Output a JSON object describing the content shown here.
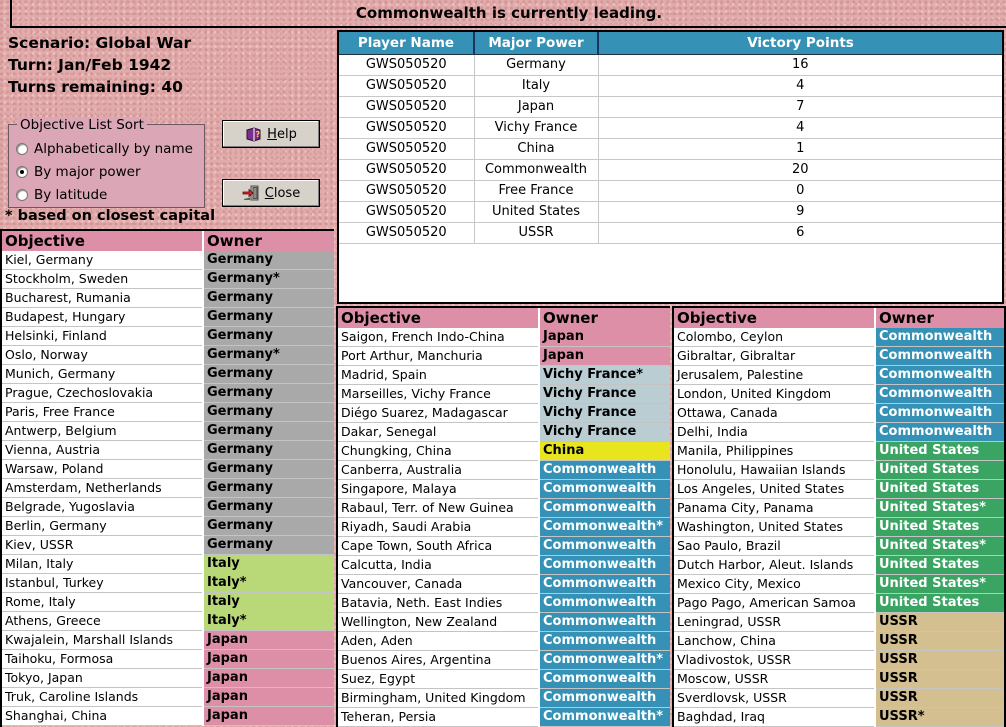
{
  "title": "Commonwealth is currently leading.",
  "scenario": {
    "scenario_line": "Scenario: Global War",
    "turn_line": "Turn: Jan/Feb 1942",
    "remaining_line": "Turns remaining: 40"
  },
  "sort_box": {
    "label": "Objective List Sort",
    "options": [
      {
        "label": "Alphabetically by name",
        "selected": false
      },
      {
        "label": "By major power",
        "selected": true
      },
      {
        "label": "By latitude",
        "selected": false
      }
    ]
  },
  "buttons": {
    "help_label": "Help",
    "close_label": "Close"
  },
  "footnote": "* based on closest capital",
  "victory_table": {
    "columns": [
      "Player Name",
      "Major Power",
      "Victory Points"
    ],
    "rows": [
      {
        "player": "GWS050520",
        "power": "Germany",
        "points": "16"
      },
      {
        "player": "GWS050520",
        "power": "Italy",
        "points": "4"
      },
      {
        "player": "GWS050520",
        "power": "Japan",
        "points": "7"
      },
      {
        "player": "GWS050520",
        "power": "Vichy France",
        "points": "4"
      },
      {
        "player": "GWS050520",
        "power": "China",
        "points": "1"
      },
      {
        "player": "GWS050520",
        "power": "Commonwealth",
        "points": "20"
      },
      {
        "player": "GWS050520",
        "power": "Free France",
        "points": "0"
      },
      {
        "player": "GWS050520",
        "power": "United States",
        "points": "9"
      },
      {
        "player": "GWS050520",
        "power": "USSR",
        "points": "6"
      }
    ]
  },
  "list_headers": {
    "objective": "Objective",
    "owner": "Owner"
  },
  "owner_styles": {
    "Germany": {
      "bg": "#a9a9a9",
      "fg": "#000000"
    },
    "Italy": {
      "bg": "#b9d878",
      "fg": "#000000"
    },
    "Japan": {
      "bg": "#de8fa8",
      "fg": "#000000"
    },
    "Vichy France": {
      "bg": "#b9cdd3",
      "fg": "#000000"
    },
    "China": {
      "bg": "#e8e51e",
      "fg": "#000000"
    },
    "Commonwealth": {
      "bg": "#3591b5",
      "fg": "#ffffff"
    },
    "United States": {
      "bg": "#3aa563",
      "fg": "#ffffff"
    },
    "USSR": {
      "bg": "#d3bf90",
      "fg": "#000000"
    }
  },
  "objective_lists": [
    {
      "rows": [
        {
          "objective": "Kiel, Germany",
          "owner": "Germany",
          "power": "Germany"
        },
        {
          "objective": "Stockholm, Sweden",
          "owner": "Germany*",
          "power": "Germany"
        },
        {
          "objective": "Bucharest, Rumania",
          "owner": "Germany",
          "power": "Germany"
        },
        {
          "objective": "Budapest, Hungary",
          "owner": "Germany",
          "power": "Germany"
        },
        {
          "objective": "Helsinki, Finland",
          "owner": "Germany",
          "power": "Germany"
        },
        {
          "objective": "Oslo, Norway",
          "owner": "Germany*",
          "power": "Germany"
        },
        {
          "objective": "Munich, Germany",
          "owner": "Germany",
          "power": "Germany"
        },
        {
          "objective": "Prague, Czechoslovakia",
          "owner": "Germany",
          "power": "Germany"
        },
        {
          "objective": "Paris, Free France",
          "owner": "Germany",
          "power": "Germany"
        },
        {
          "objective": "Antwerp, Belgium",
          "owner": "Germany",
          "power": "Germany"
        },
        {
          "objective": "Vienna, Austria",
          "owner": "Germany",
          "power": "Germany"
        },
        {
          "objective": "Warsaw, Poland",
          "owner": "Germany",
          "power": "Germany"
        },
        {
          "objective": "Amsterdam, Netherlands",
          "owner": "Germany",
          "power": "Germany"
        },
        {
          "objective": "Belgrade, Yugoslavia",
          "owner": "Germany",
          "power": "Germany"
        },
        {
          "objective": "Berlin, Germany",
          "owner": "Germany",
          "power": "Germany"
        },
        {
          "objective": "Kiev, USSR",
          "owner": "Germany",
          "power": "Germany"
        },
        {
          "objective": "Milan, Italy",
          "owner": "Italy",
          "power": "Italy"
        },
        {
          "objective": "Istanbul, Turkey",
          "owner": "Italy*",
          "power": "Italy"
        },
        {
          "objective": "Rome, Italy",
          "owner": "Italy",
          "power": "Italy"
        },
        {
          "objective": "Athens, Greece",
          "owner": "Italy*",
          "power": "Italy"
        },
        {
          "objective": "Kwajalein, Marshall Islands",
          "owner": "Japan",
          "power": "Japan"
        },
        {
          "objective": "Taihoku, Formosa",
          "owner": "Japan",
          "power": "Japan"
        },
        {
          "objective": "Tokyo, Japan",
          "owner": "Japan",
          "power": "Japan"
        },
        {
          "objective": "Truk, Caroline Islands",
          "owner": "Japan",
          "power": "Japan"
        },
        {
          "objective": "Shanghai, China",
          "owner": "Japan",
          "power": "Japan"
        }
      ]
    },
    {
      "rows": [
        {
          "objective": "Saigon, French Indo-China",
          "owner": "Japan",
          "power": "Japan"
        },
        {
          "objective": "Port Arthur, Manchuria",
          "owner": "Japan",
          "power": "Japan"
        },
        {
          "objective": "Madrid, Spain",
          "owner": "Vichy France*",
          "power": "Vichy France"
        },
        {
          "objective": "Marseilles, Vichy France",
          "owner": "Vichy France",
          "power": "Vichy France"
        },
        {
          "objective": "Diégo Suarez, Madagascar",
          "owner": "Vichy France",
          "power": "Vichy France"
        },
        {
          "objective": "Dakar, Senegal",
          "owner": "Vichy France",
          "power": "Vichy France"
        },
        {
          "objective": "Chungking, China",
          "owner": "China",
          "power": "China"
        },
        {
          "objective": "Canberra, Australia",
          "owner": "Commonwealth",
          "power": "Commonwealth"
        },
        {
          "objective": "Singapore, Malaya",
          "owner": "Commonwealth",
          "power": "Commonwealth"
        },
        {
          "objective": "Rabaul, Terr. of New Guinea",
          "owner": "Commonwealth",
          "power": "Commonwealth"
        },
        {
          "objective": "Riyadh, Saudi Arabia",
          "owner": "Commonwealth*",
          "power": "Commonwealth"
        },
        {
          "objective": "Cape Town, South Africa",
          "owner": "Commonwealth",
          "power": "Commonwealth"
        },
        {
          "objective": "Calcutta, India",
          "owner": "Commonwealth",
          "power": "Commonwealth"
        },
        {
          "objective": "Vancouver, Canada",
          "owner": "Commonwealth",
          "power": "Commonwealth"
        },
        {
          "objective": "Batavia, Neth. East Indies",
          "owner": "Commonwealth",
          "power": "Commonwealth"
        },
        {
          "objective": "Wellington, New Zealand",
          "owner": "Commonwealth",
          "power": "Commonwealth"
        },
        {
          "objective": "Aden, Aden",
          "owner": "Commonwealth",
          "power": "Commonwealth"
        },
        {
          "objective": "Buenos Aires, Argentina",
          "owner": "Commonwealth*",
          "power": "Commonwealth"
        },
        {
          "objective": "Suez, Egypt",
          "owner": "Commonwealth",
          "power": "Commonwealth"
        },
        {
          "objective": "Birmingham, United Kingdom",
          "owner": "Commonwealth",
          "power": "Commonwealth"
        },
        {
          "objective": "Teheran, Persia",
          "owner": "Commonwealth*",
          "power": "Commonwealth"
        }
      ]
    },
    {
      "rows": [
        {
          "objective": "Colombo, Ceylon",
          "owner": "Commonwealth",
          "power": "Commonwealth"
        },
        {
          "objective": "Gibraltar, Gibraltar",
          "owner": "Commonwealth",
          "power": "Commonwealth"
        },
        {
          "objective": "Jerusalem, Palestine",
          "owner": "Commonwealth",
          "power": "Commonwealth"
        },
        {
          "objective": "London, United Kingdom",
          "owner": "Commonwealth",
          "power": "Commonwealth"
        },
        {
          "objective": "Ottawa, Canada",
          "owner": "Commonwealth",
          "power": "Commonwealth"
        },
        {
          "objective": "Delhi, India",
          "owner": "Commonwealth",
          "power": "Commonwealth"
        },
        {
          "objective": "Manila, Philippines",
          "owner": "United States",
          "power": "United States"
        },
        {
          "objective": "Honolulu, Hawaiian Islands",
          "owner": "United States",
          "power": "United States"
        },
        {
          "objective": "Los Angeles, United States",
          "owner": "United States",
          "power": "United States"
        },
        {
          "objective": "Panama City, Panama",
          "owner": "United States*",
          "power": "United States"
        },
        {
          "objective": "Washington, United States",
          "owner": "United States",
          "power": "United States"
        },
        {
          "objective": "Sao Paulo, Brazil",
          "owner": "United States*",
          "power": "United States"
        },
        {
          "objective": "Dutch Harbor, Aleut. Islands",
          "owner": "United States",
          "power": "United States"
        },
        {
          "objective": "Mexico City, Mexico",
          "owner": "United States*",
          "power": "United States"
        },
        {
          "objective": "Pago Pago, American Samoa",
          "owner": "United States",
          "power": "United States"
        },
        {
          "objective": "Leningrad, USSR",
          "owner": "USSR",
          "power": "USSR"
        },
        {
          "objective": "Lanchow, China",
          "owner": "USSR",
          "power": "USSR"
        },
        {
          "objective": "Vladivostok, USSR",
          "owner": "USSR",
          "power": "USSR"
        },
        {
          "objective": "Moscow, USSR",
          "owner": "USSR",
          "power": "USSR"
        },
        {
          "objective": "Sverdlovsk, USSR",
          "owner": "USSR",
          "power": "USSR"
        },
        {
          "objective": "Baghdad, Iraq",
          "owner": "USSR*",
          "power": "USSR"
        }
      ]
    }
  ]
}
